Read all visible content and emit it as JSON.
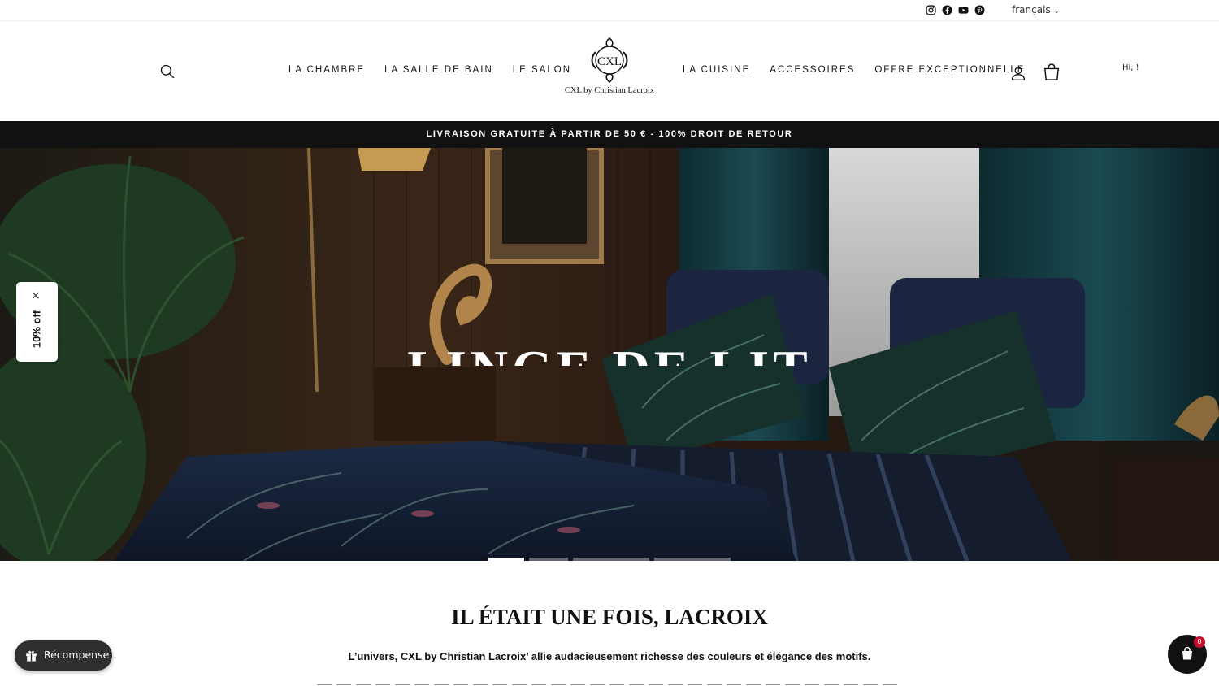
{
  "topbar": {
    "social_icons": [
      "instagram-icon",
      "facebook-icon",
      "youtube-icon",
      "pinterest-icon"
    ],
    "language": "français"
  },
  "header": {
    "nav_left": [
      "LA CHAMBRE",
      "LA SALLE DE BAIN",
      "LE SALON"
    ],
    "nav_right": [
      "LA CUISINE",
      "ACCESSOIRES",
      "OFFRE EXCEPTIONNELLE"
    ],
    "logo_monogram": "CXL",
    "logo_text": "CXL by Christian Lacroix",
    "greeting": "Hi, !"
  },
  "announcement": "LIVRAISON GRATUITE À PARTIR DE 50 € - 100% DROIT DE RETOUR",
  "hero": {
    "title": "LINGE DE LIT",
    "slide_count": 4,
    "active_slide": 1
  },
  "discount_tab": {
    "label": "10% off",
    "close": "×"
  },
  "story": {
    "title": "IL ÉTAIT UNE FOIS, LACROIX",
    "subtitle": "L’univers, CXL by Christian Lacroix’ allie audacieusement richesse des couleurs et élégance des motifs."
  },
  "reward_button": {
    "label": "Récompense"
  },
  "chat_bubble": {
    "badge": "0"
  },
  "colors": {
    "text": "#111111",
    "announcement_bg": "#111111",
    "badge": "#c8102e",
    "reward_bg": "#2f2f2f"
  }
}
